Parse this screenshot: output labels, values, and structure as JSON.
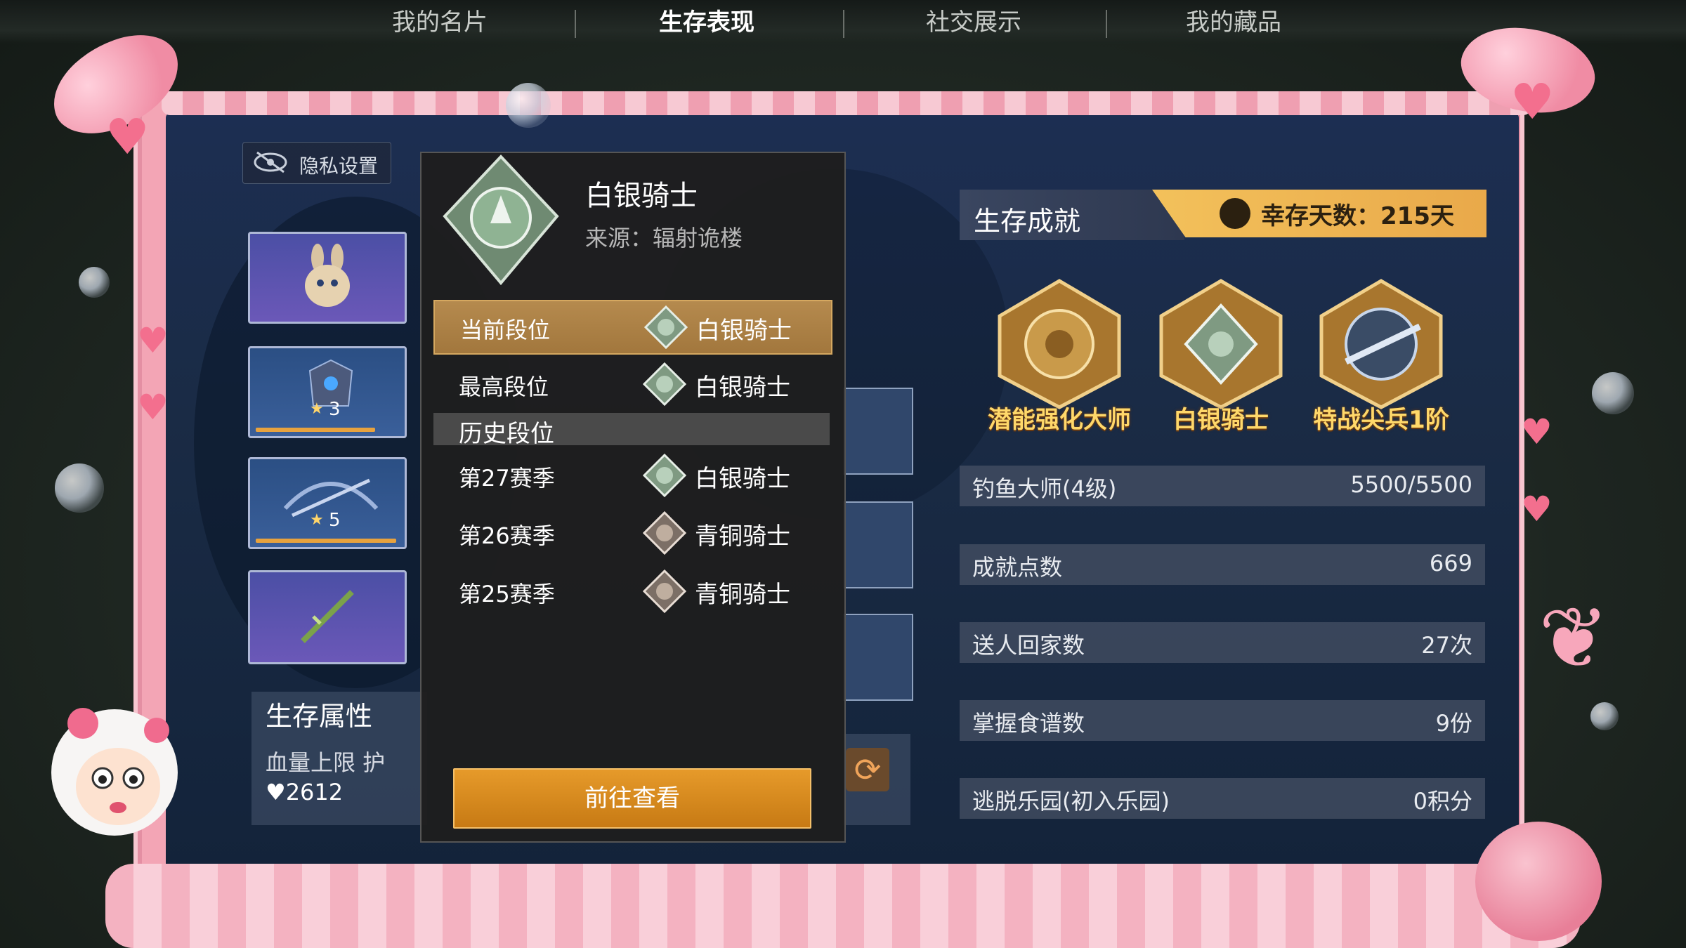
{
  "nav": {
    "tabs": [
      {
        "label": "我的名片"
      },
      {
        "label": "生存表现"
      },
      {
        "label": "社交展示"
      },
      {
        "label": "我的藏品"
      }
    ]
  },
  "privacy": {
    "label": "隐私设置"
  },
  "slots": [
    {
      "icon": "rabbit-backpack-icon"
    },
    {
      "icon": "armor-icon",
      "stars": "3"
    },
    {
      "icon": "crossbow-icon",
      "stars": "5"
    },
    {
      "icon": "rifle-icon"
    }
  ],
  "survival_attrs": {
    "title": "生存属性",
    "labels": "血量上限  护",
    "hp": "2612"
  },
  "rank_popup": {
    "name": "白银骑士",
    "source": "来源：辐射诡楼",
    "current": {
      "label": "当前段位",
      "value": "白银骑士"
    },
    "highest": {
      "label": "最高段位",
      "value": "白银骑士"
    },
    "history_title": "历史段位",
    "history": [
      {
        "season": "第27赛季",
        "rank": "白银骑士"
      },
      {
        "season": "第26赛季",
        "rank": "青铜骑士"
      },
      {
        "season": "第25赛季",
        "rank": "青铜骑士"
      }
    ],
    "goto_label": "前往查看"
  },
  "achievements": {
    "title": "生存成就",
    "survival_days": "幸存天数：215天",
    "badges": [
      {
        "label": "潜能强化大师",
        "icon": "potential-master-badge-icon"
      },
      {
        "label": "白银骑士",
        "icon": "silver-knight-badge-icon"
      },
      {
        "label": "特战尖兵1阶",
        "icon": "special-ops-badge-icon"
      }
    ],
    "stats": [
      {
        "key": "钓鱼大师(4级)",
        "value": "5500/5500"
      },
      {
        "key": "成就点数",
        "value": "669"
      },
      {
        "key": "送人回家数",
        "value": "27次"
      },
      {
        "key": "掌握食谱数",
        "value": "9份"
      },
      {
        "key": "逃脱乐园(初入乐园)",
        "value": "0积分"
      }
    ]
  },
  "colors": {
    "accent": "#e69a2a",
    "frame": "#f3a5b5",
    "gold_text": "#ffd86a"
  }
}
